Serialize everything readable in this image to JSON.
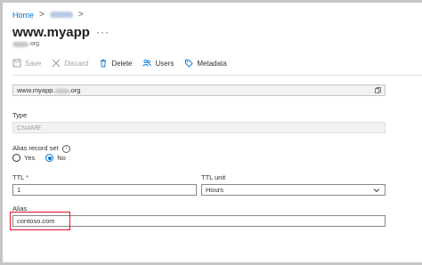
{
  "breadcrumb": {
    "home": "Home",
    "separator": ">"
  },
  "header": {
    "title": "www.myapp",
    "more": "···",
    "subtitle_suffix": ".org"
  },
  "toolbar": {
    "save": "Save",
    "discard": "Discard",
    "delete": "Delete",
    "users": "Users",
    "metadata": "Metadata"
  },
  "fqdn": {
    "prefix": "www.myapp.",
    "suffix": ".org"
  },
  "type": {
    "label": "Type",
    "value": "CNAME"
  },
  "alias_record_set": {
    "label": "Alias record set",
    "yes": "Yes",
    "no": "No",
    "selected": "No"
  },
  "ttl": {
    "label": "TTL",
    "required_marker": "*",
    "value": "1"
  },
  "ttl_unit": {
    "label": "TTL unit",
    "value": "Hours"
  },
  "alias": {
    "label": "Alias",
    "value": "contoso.com"
  },
  "colors": {
    "accent": "#0078d4",
    "highlight": "#e81123",
    "required": "#a4262c"
  }
}
